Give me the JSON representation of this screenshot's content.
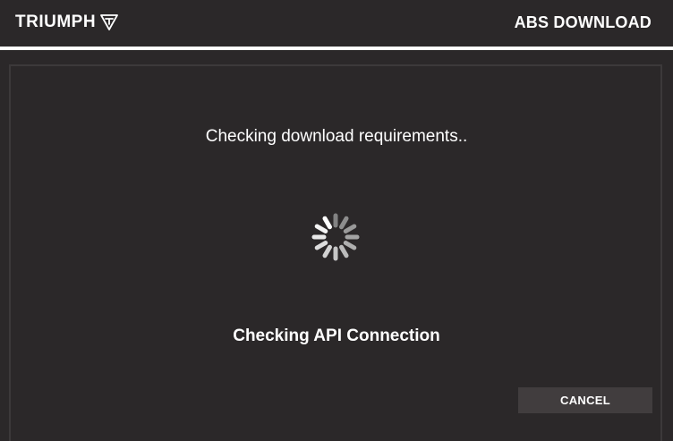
{
  "header": {
    "logo_text": "TRIUMPH",
    "title": "ABS DOWNLOAD"
  },
  "dialog": {
    "requirements_text": "Checking download requirements..",
    "status_text": "Checking API Connection",
    "cancel_label": "CANCEL"
  },
  "icons": {
    "logo_mark": "triumph-t-logo-icon",
    "spinner": "loading-spinner-icon"
  },
  "colors": {
    "background": "#2b2829",
    "divider": "#ffffff",
    "button": "#413d3e",
    "text": "#ffffff"
  }
}
